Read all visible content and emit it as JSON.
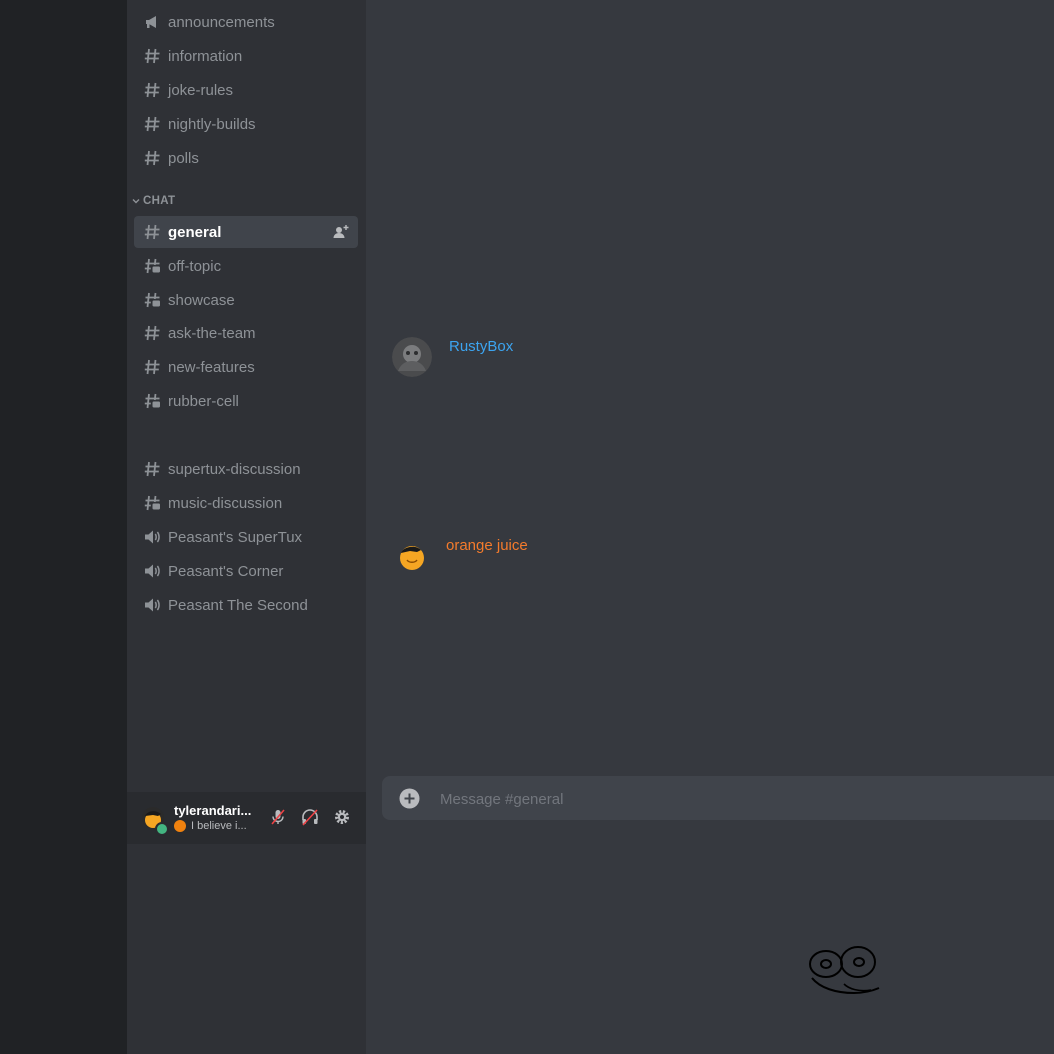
{
  "channels_top": [
    {
      "name": "announcements",
      "icon": "megaphone-icon"
    },
    {
      "name": "information",
      "icon": "hash-icon"
    },
    {
      "name": "joke-rules",
      "icon": "hash-icon"
    },
    {
      "name": "nightly-builds",
      "icon": "hash-icon"
    },
    {
      "name": "polls",
      "icon": "hash-icon"
    }
  ],
  "category": {
    "label": "CHAT"
  },
  "channels_chat": [
    {
      "name": "general",
      "icon": "hash-icon",
      "active": true
    },
    {
      "name": "off-topic",
      "icon": "hash-thread-icon"
    },
    {
      "name": "showcase",
      "icon": "hash-thread-icon"
    },
    {
      "name": "ask-the-team",
      "icon": "hash-icon"
    },
    {
      "name": "new-features",
      "icon": "hash-icon"
    },
    {
      "name": "rubber-cell",
      "icon": "hash-thread-icon"
    }
  ],
  "channels_other": [
    {
      "name": "supertux-discussion",
      "icon": "hash-icon"
    },
    {
      "name": "music-discussion",
      "icon": "hash-thread-icon"
    },
    {
      "name": "Peasant's SuperTux",
      "icon": "speaker-icon"
    },
    {
      "name": "Peasant's Corner",
      "icon": "speaker-icon"
    },
    {
      "name": "Peasant The Second",
      "icon": "speaker-icon"
    }
  ],
  "user": {
    "name": "tylerandari...",
    "status": "I believe i..."
  },
  "messages": [
    {
      "author": "RustyBox",
      "color": "#3ca4f0"
    },
    {
      "author": "orange juice",
      "color": "#f47b2c"
    }
  ],
  "composer": {
    "placeholder": "Message #general"
  },
  "colors": {
    "accent_blue": "#3ca4f0",
    "accent_orange": "#f47b2c",
    "online": "#43b581"
  }
}
